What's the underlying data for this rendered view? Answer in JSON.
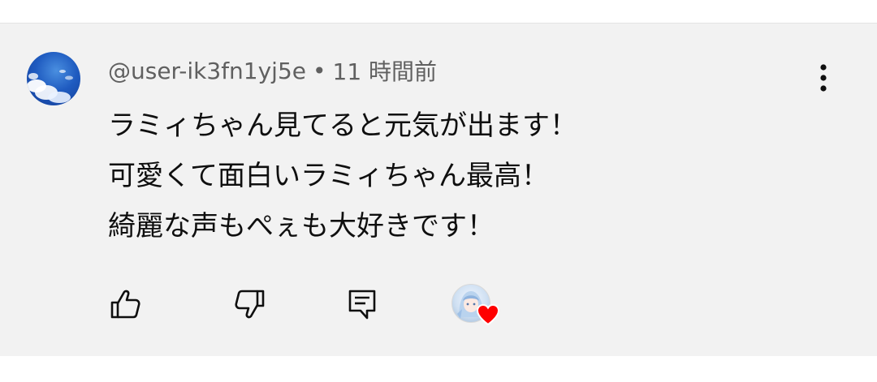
{
  "comment": {
    "author": "@user-ik3fn1yj5e",
    "separator": "•",
    "timestamp": "11 時間前",
    "lines": [
      "ラミィちゃん見てると元気が出ます！",
      "可愛くて面白いラミィちゃん最高！",
      "綺麗な声もぺぇも大好きです！"
    ]
  },
  "actions": {
    "like_icon": "thumbs-up-icon",
    "dislike_icon": "thumbs-down-icon",
    "reply_icon": "reply-comment-icon",
    "more_icon": "more-vertical-icon",
    "creator_heart_icon": "creator-heart-icon"
  },
  "colors": {
    "card_background": "#f2f2f2",
    "meta_text": "#606060",
    "body_text": "#0f0f0f",
    "icon": "#0f0f0f",
    "heart": "#ff0000"
  }
}
